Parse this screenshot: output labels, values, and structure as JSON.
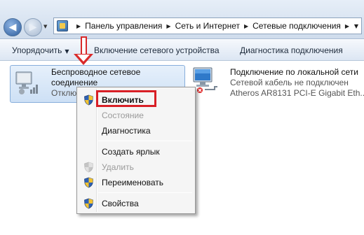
{
  "nav": {
    "back_glyph": "◀",
    "forward_glyph": "▶",
    "dropdown_glyph": "▼"
  },
  "address": {
    "crumbs": [
      "Панель управления",
      "Сеть и Интернет",
      "Сетевые подключения"
    ],
    "separator": "▶",
    "dropdown_glyph": "▼"
  },
  "commandbar": {
    "organize": "Упорядочить",
    "enable_device": "Включение сетевого устройства",
    "diagnose": "Диагностика подключения",
    "dropdown_glyph": "▼"
  },
  "connections": {
    "wireless": {
      "title_line1": "Беспроводное сетевое",
      "title_line2": "соединение",
      "status": "Отключ"
    },
    "lan": {
      "title": "Подключение по локальной сети",
      "status": "Сетевой кабель не подключен",
      "adapter": "Atheros AR8131 PCI-E Gigabit Eth..."
    }
  },
  "context_menu": {
    "items": [
      {
        "label": "Включить",
        "shield": true,
        "disabled": false,
        "bold": true
      },
      {
        "label": "Состояние",
        "shield": false,
        "disabled": true,
        "bold": false
      },
      {
        "label": "Диагностика",
        "shield": false,
        "disabled": false,
        "bold": false
      },
      {
        "label": "Создать ярлык",
        "shield": false,
        "disabled": false,
        "bold": false
      },
      {
        "label": "Удалить",
        "shield": true,
        "disabled": true,
        "bold": false
      },
      {
        "label": "Переименовать",
        "shield": true,
        "disabled": false,
        "bold": false
      },
      {
        "label": "Свойства",
        "shield": true,
        "disabled": false,
        "bold": false
      }
    ]
  },
  "colors": {
    "annotation_red": "#d81f26",
    "selection_blue": "#cde0f5"
  },
  "icons": {
    "back": "back-arrow-icon",
    "forward": "forward-arrow-icon",
    "control_panel": "control-panel-icon",
    "wireless": "wireless-network-adapter-icon",
    "lan": "lan-network-adapter-icon",
    "shield": "uac-shield-icon",
    "annotation": "red-down-arrow-icon"
  }
}
